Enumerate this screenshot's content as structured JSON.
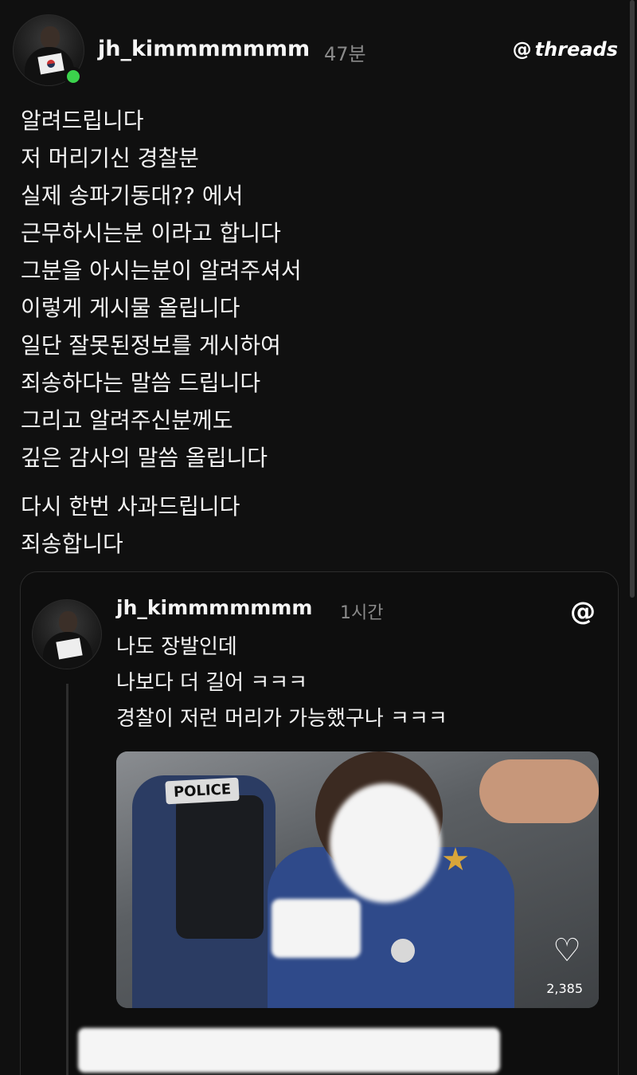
{
  "post": {
    "username": "jh_kimmmmmmm",
    "time": "47분",
    "brand": {
      "logo_glyph": "@",
      "name": "threads"
    },
    "paragraphs": [
      [
        "알려드립니다",
        "저 머리기신 경찰분",
        "실제 송파기동대?? 에서",
        "근무하시는분 이라고 합니다",
        "그분을 아시는분이 알려주셔서",
        "이렇게 게시물 올립니다",
        "일단 잘못된정보를 게시하여",
        "죄송하다는 말씀 드립니다",
        "그리고 알려주신분께도",
        "깊은 감사의 말씀 올립니다"
      ],
      [
        "다시 한번 사과드립니다",
        "죄송합니다"
      ]
    ]
  },
  "quoted": {
    "username": "jh_kimmmmmmm",
    "time": "1시간",
    "logo_glyph": "@",
    "lines": [
      "나도 장발인데",
      "나보다 더 길어 ㅋㅋㅋ",
      "경찰이 저런 머리가 가능했구나 ㅋㅋㅋ"
    ],
    "media": {
      "patch_text": "POLICE",
      "likes": "2,385",
      "heart_icon": "heart-outline"
    }
  },
  "colors": {
    "background": "#101010",
    "text": "#f3f3f3",
    "muted": "#8a8a8a",
    "online": "#3bd34c"
  }
}
